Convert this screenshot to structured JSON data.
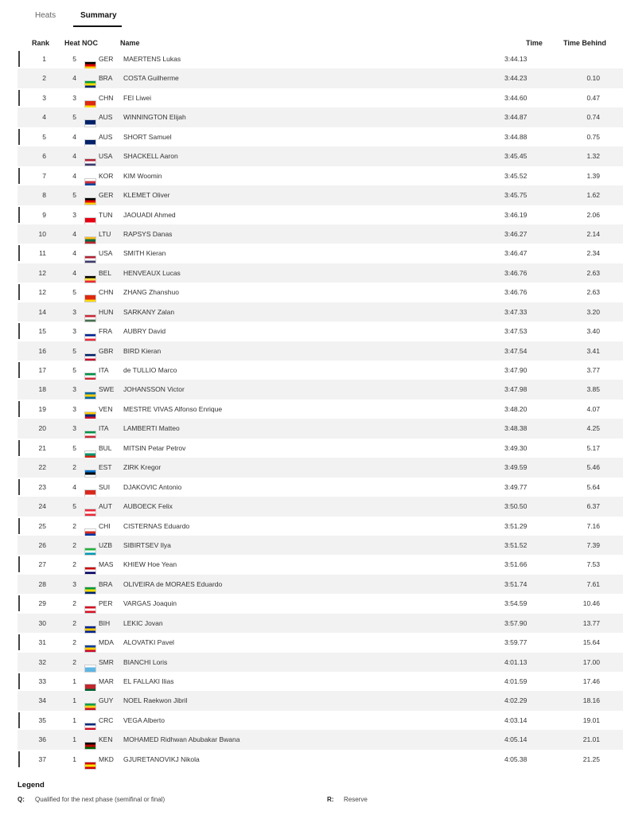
{
  "tabs": [
    {
      "label": "Heats",
      "active": false
    },
    {
      "label": "Summary",
      "active": true
    }
  ],
  "columns": {
    "rank": "Rank",
    "heat_noc": "Heat NOC",
    "name": "Name",
    "time": "Time",
    "time_behind": "Time Behind"
  },
  "colors": {
    "accent": "#111111",
    "row_alt": "#f2f2f2"
  },
  "rows": [
    {
      "rank": "1",
      "heat": "5",
      "noc": "GER",
      "name": "MAERTENS Lukas",
      "time": "3:44.13",
      "behind": "",
      "q": true
    },
    {
      "rank": "2",
      "heat": "4",
      "noc": "BRA",
      "name": "COSTA Guilherme",
      "time": "3:44.23",
      "behind": "0.10",
      "q": false
    },
    {
      "rank": "3",
      "heat": "3",
      "noc": "CHN",
      "name": "FEI Liwei",
      "time": "3:44.60",
      "behind": "0.47",
      "q": true
    },
    {
      "rank": "4",
      "heat": "5",
      "noc": "AUS",
      "name": "WINNINGTON Elijah",
      "time": "3:44.87",
      "behind": "0.74",
      "q": false
    },
    {
      "rank": "5",
      "heat": "4",
      "noc": "AUS",
      "name": "SHORT Samuel",
      "time": "3:44.88",
      "behind": "0.75",
      "q": true
    },
    {
      "rank": "6",
      "heat": "4",
      "noc": "USA",
      "name": "SHACKELL Aaron",
      "time": "3:45.45",
      "behind": "1.32",
      "q": false
    },
    {
      "rank": "7",
      "heat": "4",
      "noc": "KOR",
      "name": "KIM Woomin",
      "time": "3:45.52",
      "behind": "1.39",
      "q": true
    },
    {
      "rank": "8",
      "heat": "5",
      "noc": "GER",
      "name": "KLEMET Oliver",
      "time": "3:45.75",
      "behind": "1.62",
      "q": false
    },
    {
      "rank": "9",
      "heat": "3",
      "noc": "TUN",
      "name": "JAOUADI Ahmed",
      "time": "3:46.19",
      "behind": "2.06",
      "q": true
    },
    {
      "rank": "10",
      "heat": "4",
      "noc": "LTU",
      "name": "RAPSYS Danas",
      "time": "3:46.27",
      "behind": "2.14",
      "q": false
    },
    {
      "rank": "11",
      "heat": "4",
      "noc": "USA",
      "name": "SMITH Kieran",
      "time": "3:46.47",
      "behind": "2.34",
      "q": true
    },
    {
      "rank": "12",
      "heat": "4",
      "noc": "BEL",
      "name": "HENVEAUX Lucas",
      "time": "3:46.76",
      "behind": "2.63",
      "q": false
    },
    {
      "rank": "12",
      "heat": "5",
      "noc": "CHN",
      "name": "ZHANG Zhanshuo",
      "time": "3:46.76",
      "behind": "2.63",
      "q": true
    },
    {
      "rank": "14",
      "heat": "3",
      "noc": "HUN",
      "name": "SARKANY Zalan",
      "time": "3:47.33",
      "behind": "3.20",
      "q": false
    },
    {
      "rank": "15",
      "heat": "3",
      "noc": "FRA",
      "name": "AUBRY David",
      "time": "3:47.53",
      "behind": "3.40",
      "q": true
    },
    {
      "rank": "16",
      "heat": "5",
      "noc": "GBR",
      "name": "BIRD Kieran",
      "time": "3:47.54",
      "behind": "3.41",
      "q": false
    },
    {
      "rank": "17",
      "heat": "5",
      "noc": "ITA",
      "name": "de TULLIO Marco",
      "time": "3:47.90",
      "behind": "3.77",
      "q": true
    },
    {
      "rank": "18",
      "heat": "3",
      "noc": "SWE",
      "name": "JOHANSSON Victor",
      "time": "3:47.98",
      "behind": "3.85",
      "q": false
    },
    {
      "rank": "19",
      "heat": "3",
      "noc": "VEN",
      "name": "MESTRE VIVAS Alfonso Enrique",
      "time": "3:48.20",
      "behind": "4.07",
      "q": true
    },
    {
      "rank": "20",
      "heat": "3",
      "noc": "ITA",
      "name": "LAMBERTI Matteo",
      "time": "3:48.38",
      "behind": "4.25",
      "q": false
    },
    {
      "rank": "21",
      "heat": "5",
      "noc": "BUL",
      "name": "MITSIN Petar Petrov",
      "time": "3:49.30",
      "behind": "5.17",
      "q": true
    },
    {
      "rank": "22",
      "heat": "2",
      "noc": "EST",
      "name": "ZIRK Kregor",
      "time": "3:49.59",
      "behind": "5.46",
      "q": false
    },
    {
      "rank": "23",
      "heat": "4",
      "noc": "SUI",
      "name": "DJAKOVIC Antonio",
      "time": "3:49.77",
      "behind": "5.64",
      "q": true
    },
    {
      "rank": "24",
      "heat": "5",
      "noc": "AUT",
      "name": "AUBOECK Felix",
      "time": "3:50.50",
      "behind": "6.37",
      "q": false
    },
    {
      "rank": "25",
      "heat": "2",
      "noc": "CHI",
      "name": "CISTERNAS Eduardo",
      "time": "3:51.29",
      "behind": "7.16",
      "q": true
    },
    {
      "rank": "26",
      "heat": "2",
      "noc": "UZB",
      "name": "SIBIRTSEV Ilya",
      "time": "3:51.52",
      "behind": "7.39",
      "q": false
    },
    {
      "rank": "27",
      "heat": "2",
      "noc": "MAS",
      "name": "KHIEW Hoe Yean",
      "time": "3:51.66",
      "behind": "7.53",
      "q": true
    },
    {
      "rank": "28",
      "heat": "3",
      "noc": "BRA",
      "name": "OLIVEIRA de MORAES Eduardo",
      "time": "3:51.74",
      "behind": "7.61",
      "q": false
    },
    {
      "rank": "29",
      "heat": "2",
      "noc": "PER",
      "name": "VARGAS Joaquin",
      "time": "3:54.59",
      "behind": "10.46",
      "q": true
    },
    {
      "rank": "30",
      "heat": "2",
      "noc": "BIH",
      "name": "LEKIC Jovan",
      "time": "3:57.90",
      "behind": "13.77",
      "q": false
    },
    {
      "rank": "31",
      "heat": "2",
      "noc": "MDA",
      "name": "ALOVATKI Pavel",
      "time": "3:59.77",
      "behind": "15.64",
      "q": true
    },
    {
      "rank": "32",
      "heat": "2",
      "noc": "SMR",
      "name": "BIANCHI Loris",
      "time": "4:01.13",
      "behind": "17.00",
      "q": false
    },
    {
      "rank": "33",
      "heat": "1",
      "noc": "MAR",
      "name": "EL FALLAKI Ilias",
      "time": "4:01.59",
      "behind": "17.46",
      "q": true
    },
    {
      "rank": "34",
      "heat": "1",
      "noc": "GUY",
      "name": "NOEL Raekwon Jibril",
      "time": "4:02.29",
      "behind": "18.16",
      "q": false
    },
    {
      "rank": "35",
      "heat": "1",
      "noc": "CRC",
      "name": "VEGA Alberto",
      "time": "4:03.14",
      "behind": "19.01",
      "q": true
    },
    {
      "rank": "36",
      "heat": "1",
      "noc": "KEN",
      "name": "MOHAMED Ridhwan Abubakar Bwana",
      "time": "4:05.14",
      "behind": "21.01",
      "q": false
    },
    {
      "rank": "37",
      "heat": "1",
      "noc": "MKD",
      "name": "GJURETANOVIKJ Nikola",
      "time": "4:05.38",
      "behind": "21.25",
      "q": true
    }
  ],
  "flags": {
    "GER": [
      "#000000",
      "#dd0000",
      "#ffce00"
    ],
    "BRA": [
      "#009c3b",
      "#ffdf00",
      "#002776"
    ],
    "CHN": [
      "#de2910",
      "#de2910",
      "#ffde00"
    ],
    "AUS": [
      "#012169",
      "#012169",
      "#ffffff"
    ],
    "USA": [
      "#b22234",
      "#ffffff",
      "#3c3b6e"
    ],
    "KOR": [
      "#ffffff",
      "#cd2e3a",
      "#0047a0"
    ],
    "TUN": [
      "#e70013",
      "#e70013",
      "#ffffff"
    ],
    "LTU": [
      "#fdb913",
      "#006a44",
      "#c1272d"
    ],
    "BEL": [
      "#000000",
      "#fae042",
      "#ed2939"
    ],
    "HUN": [
      "#ce2939",
      "#ffffff",
      "#477050"
    ],
    "FRA": [
      "#002395",
      "#ffffff",
      "#ed2939"
    ],
    "GBR": [
      "#012169",
      "#ffffff",
      "#c8102e"
    ],
    "ITA": [
      "#009246",
      "#ffffff",
      "#ce2b37"
    ],
    "SWE": [
      "#006aa7",
      "#fecc00",
      "#006aa7"
    ],
    "VEN": [
      "#ffcc00",
      "#00247d",
      "#cf142b"
    ],
    "BUL": [
      "#ffffff",
      "#00966e",
      "#d62612"
    ],
    "EST": [
      "#0072ce",
      "#000000",
      "#ffffff"
    ],
    "SUI": [
      "#da291c",
      "#da291c",
      "#ffffff"
    ],
    "AUT": [
      "#ed2939",
      "#ffffff",
      "#ed2939"
    ],
    "CHI": [
      "#ffffff",
      "#d52b1e",
      "#0039a6"
    ],
    "UZB": [
      "#1eb53a",
      "#ffffff",
      "#0099b5"
    ],
    "MAS": [
      "#cc0001",
      "#ffffff",
      "#010066"
    ],
    "PER": [
      "#d91023",
      "#ffffff",
      "#d91023"
    ],
    "BIH": [
      "#002395",
      "#fecb00",
      "#002395"
    ],
    "MDA": [
      "#003da5",
      "#ffd200",
      "#cc092f"
    ],
    "SMR": [
      "#ffffff",
      "#5eb6e4",
      "#5eb6e4"
    ],
    "MAR": [
      "#c1272d",
      "#c1272d",
      "#006233"
    ],
    "GUY": [
      "#009e49",
      "#fcd116",
      "#ce1126"
    ],
    "CRC": [
      "#002b7f",
      "#ffffff",
      "#ce1126"
    ],
    "KEN": [
      "#000000",
      "#bb0000",
      "#006600"
    ],
    "MKD": [
      "#d20000",
      "#ffe600",
      "#d20000"
    ]
  },
  "legend": {
    "title": "Legend",
    "items": [
      {
        "key": "Q:",
        "text": "Qualified for the next phase (semifinal or final)"
      },
      {
        "key": "R:",
        "text": "Reserve"
      }
    ]
  }
}
